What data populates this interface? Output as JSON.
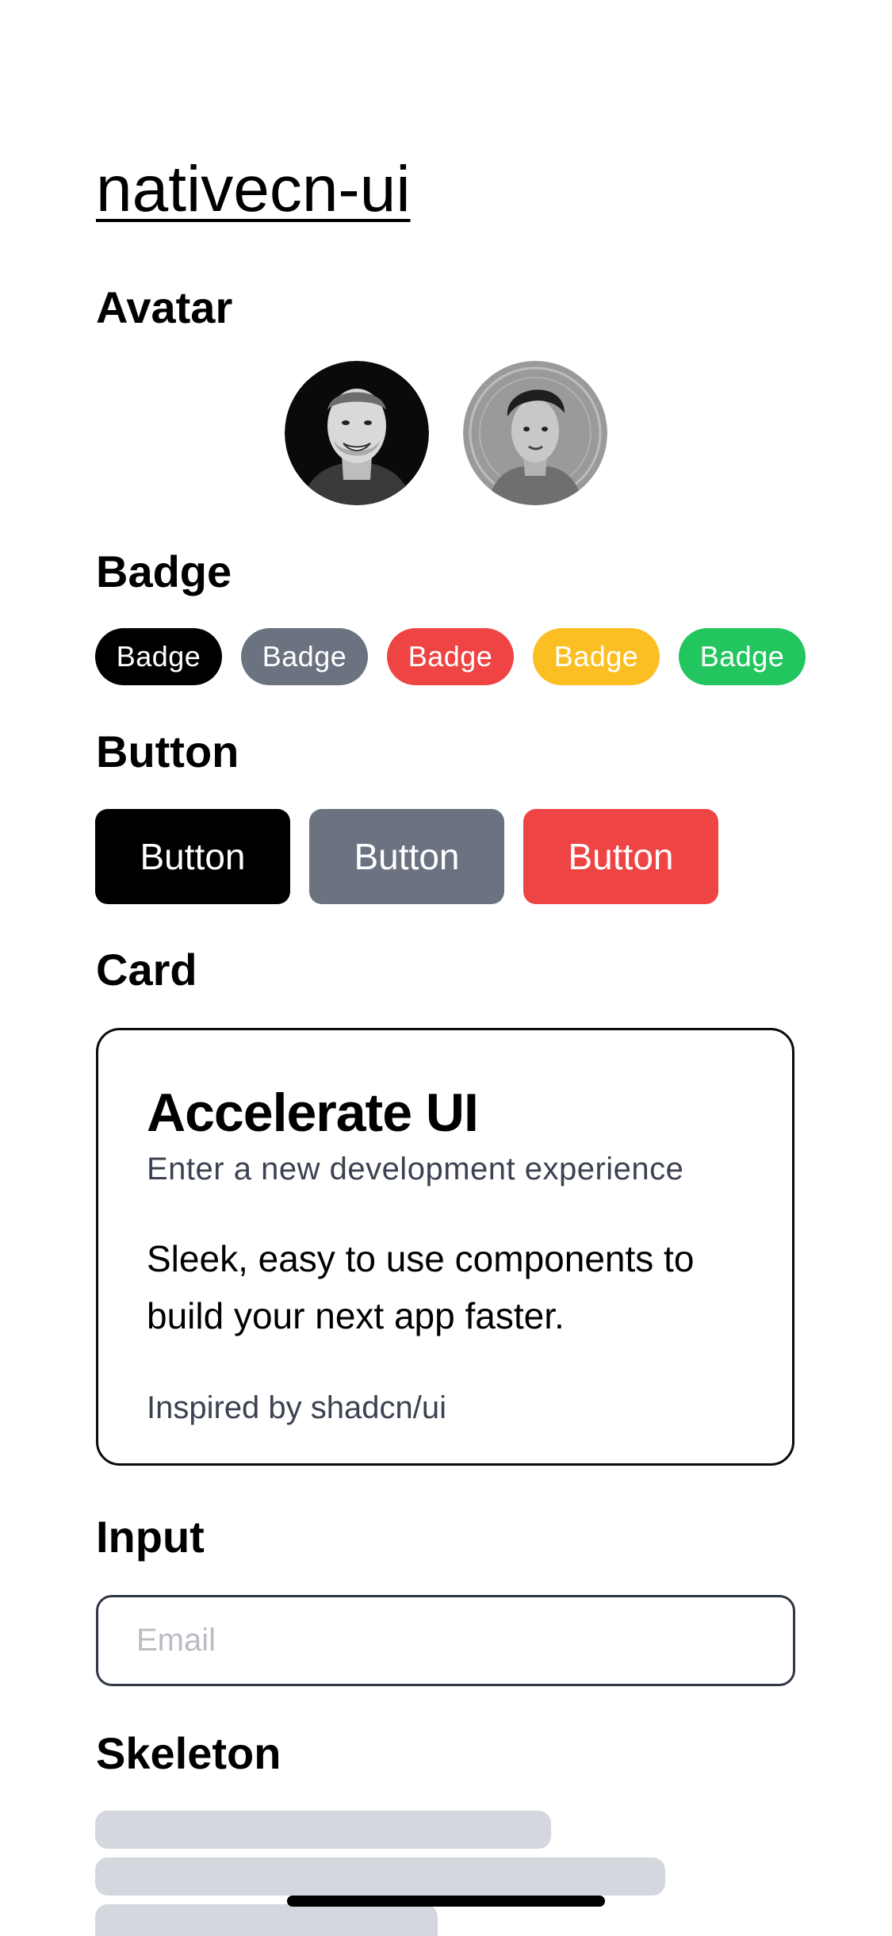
{
  "app": {
    "title": "nativecn-ui"
  },
  "sections": {
    "avatar": "Avatar",
    "badge": "Badge",
    "button": "Button",
    "card": "Card",
    "input": "Input",
    "skeleton": "Skeleton"
  },
  "badges": [
    {
      "label": "Badge",
      "color": "#000000"
    },
    {
      "label": "Badge",
      "color": "#6b7280"
    },
    {
      "label": "Badge",
      "color": "#ef4444"
    },
    {
      "label": "Badge",
      "color": "#fbbf24"
    },
    {
      "label": "Badge",
      "color": "#22c55e"
    }
  ],
  "buttons": [
    {
      "label": "Button",
      "color": "#000000"
    },
    {
      "label": "Button",
      "color": "#6b7280"
    },
    {
      "label": "Button",
      "color": "#ef4444"
    }
  ],
  "card": {
    "title": "Accelerate UI",
    "description": "Enter a new development experience",
    "content": "Sleek, easy to use components to build your next app faster.",
    "footer": "Inspired by shadcn/ui"
  },
  "input": {
    "placeholder": "Email",
    "value": ""
  },
  "skeleton": {
    "color": "#d4d7dd"
  }
}
